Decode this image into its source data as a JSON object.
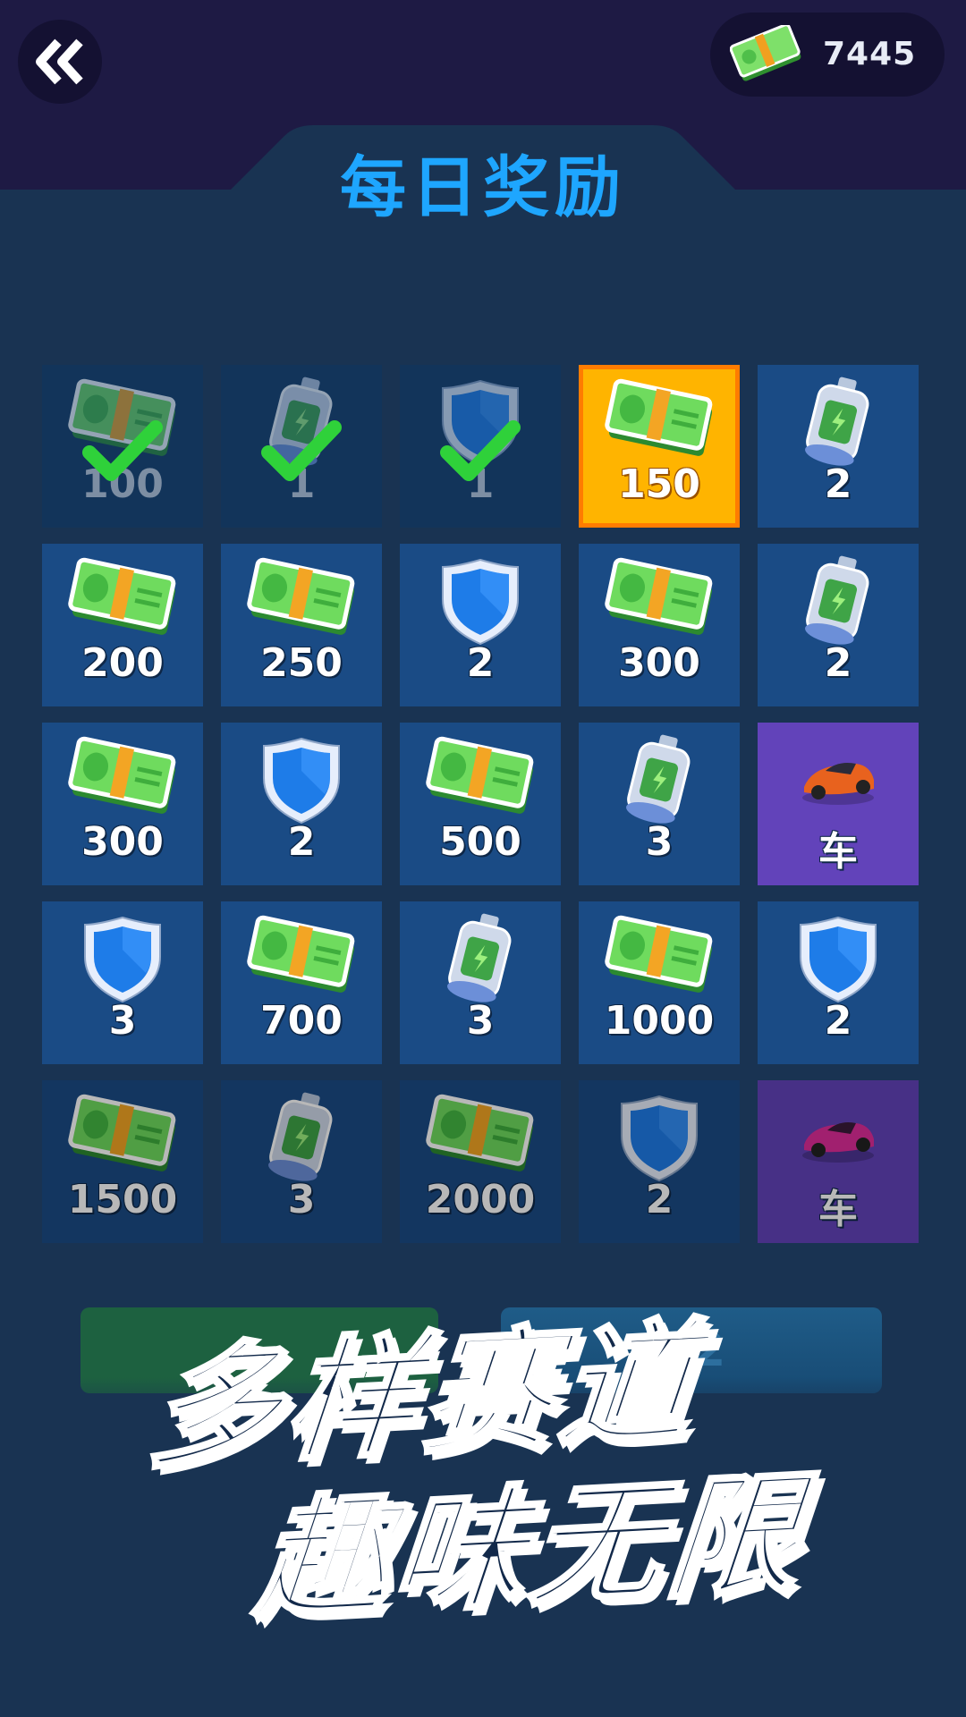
{
  "header": {
    "cash_value": "7445",
    "title": "每日奖励"
  },
  "rewards": [
    {
      "type": "cash",
      "amount": "100",
      "state": "claimed"
    },
    {
      "type": "battery",
      "amount": "1",
      "state": "claimed"
    },
    {
      "type": "shield",
      "amount": "1",
      "state": "claimed"
    },
    {
      "type": "cash",
      "amount": "150",
      "state": "current"
    },
    {
      "type": "battery",
      "amount": "2",
      "state": "locked"
    },
    {
      "type": "cash",
      "amount": "200",
      "state": "locked"
    },
    {
      "type": "cash",
      "amount": "250",
      "state": "locked"
    },
    {
      "type": "shield",
      "amount": "2",
      "state": "locked"
    },
    {
      "type": "cash",
      "amount": "300",
      "state": "locked"
    },
    {
      "type": "battery",
      "amount": "2",
      "state": "locked"
    },
    {
      "type": "cash",
      "amount": "300",
      "state": "locked"
    },
    {
      "type": "shield",
      "amount": "2",
      "state": "locked"
    },
    {
      "type": "cash",
      "amount": "500",
      "state": "locked"
    },
    {
      "type": "battery",
      "amount": "3",
      "state": "locked"
    },
    {
      "type": "car-orange",
      "amount": "车",
      "state": "locked"
    },
    {
      "type": "shield",
      "amount": "3",
      "state": "locked"
    },
    {
      "type": "cash",
      "amount": "700",
      "state": "locked"
    },
    {
      "type": "battery",
      "amount": "3",
      "state": "locked"
    },
    {
      "type": "cash",
      "amount": "1000",
      "state": "locked"
    },
    {
      "type": "shield",
      "amount": "2",
      "state": "locked"
    },
    {
      "type": "cash",
      "amount": "1500",
      "state": "locked"
    },
    {
      "type": "battery",
      "amount": "3",
      "state": "locked"
    },
    {
      "type": "cash",
      "amount": "2000",
      "state": "locked"
    },
    {
      "type": "shield",
      "amount": "2",
      "state": "locked"
    },
    {
      "type": "car-pink",
      "amount": "车",
      "state": "locked"
    }
  ],
  "buttons": {
    "double_label": "X2"
  },
  "slogan": {
    "line1": "多样赛道",
    "line2": "趣味无限"
  },
  "icons": {
    "back": "double-chevron-left-icon",
    "cash": "cash-icon",
    "check": "check-icon"
  },
  "colors": {
    "accent_title": "#1ea6ff",
    "current_cell": "#ffb400",
    "car_cell": "#6243ba",
    "cell": "#1a4b85"
  }
}
